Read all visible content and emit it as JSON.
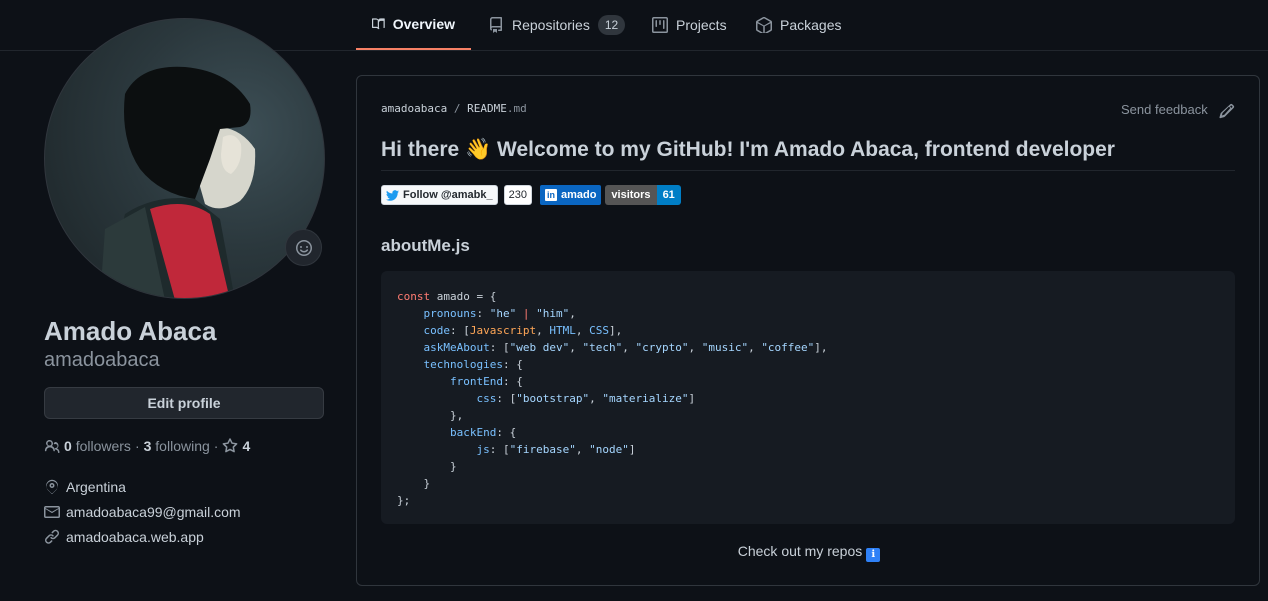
{
  "tabs": [
    {
      "label": "Overview",
      "active": true,
      "icon": "book-icon"
    },
    {
      "label": "Repositories",
      "count": "12",
      "icon": "repo-icon"
    },
    {
      "label": "Projects",
      "icon": "project-icon"
    },
    {
      "label": "Packages",
      "icon": "package-icon"
    }
  ],
  "profile": {
    "full_name": "Amado Abaca",
    "username": "amadoabaca",
    "edit_label": "Edit profile",
    "followers_count": "0",
    "followers_label": "followers",
    "following_count": "3",
    "following_label": "following",
    "stars_count": "4",
    "location": "Argentina",
    "email": "amadoabaca99@gmail.com",
    "website": "amadoabaca.web.app"
  },
  "readme": {
    "owner": "amadoabaca",
    "separator": "/",
    "file": "README",
    "ext": ".md",
    "feedback_label": "Send feedback",
    "heading": "Hi there 👋 Welcome to my GitHub! I'm Amado Abaca, frontend developer",
    "badges": {
      "twitter_label": "Follow @amabk_",
      "twitter_count": "230",
      "linkedin_label": "amado",
      "visitors_label": "visitors",
      "visitors_count": "61"
    },
    "subheading": "aboutMe.js",
    "footer_text": "Check out my repos",
    "footer_icon": "ℹ"
  },
  "colors": {
    "background": "#0d1117",
    "accent_tab": "#f78166",
    "code_bg": "#161b22"
  }
}
